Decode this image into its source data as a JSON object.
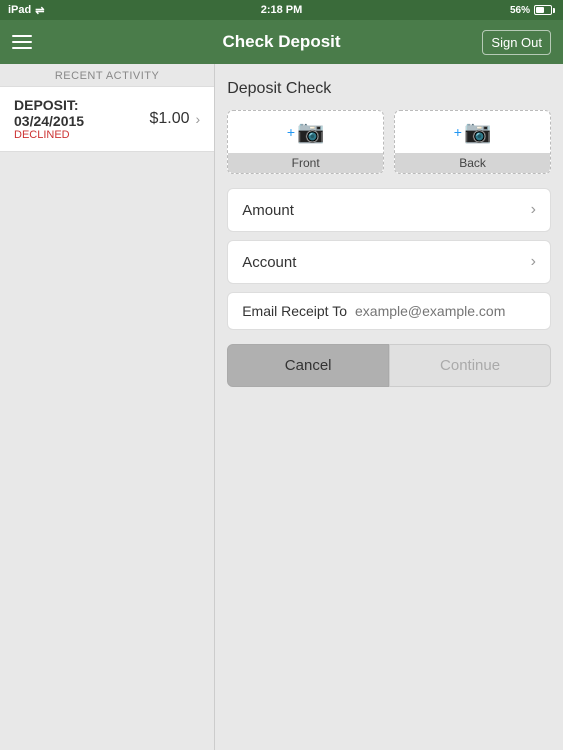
{
  "statusBar": {
    "carrier": "iPad",
    "time": "2:18 PM",
    "battery_pct": "56%",
    "wifi": true
  },
  "navBar": {
    "title": "Check Deposit",
    "signOut": "Sign Out"
  },
  "leftPanel": {
    "sectionHeader": "RECENT ACTIVITY",
    "deposit": {
      "label": "DEPOSIT:",
      "date": "03/24/2015",
      "status": "DECLINED",
      "amount": "$1.00"
    }
  },
  "rightPanel": {
    "title": "Deposit Check",
    "front_label": "Front",
    "back_label": "Back",
    "amount_label": "Amount",
    "account_label": "Account",
    "email_label": "Email Receipt To",
    "email_placeholder": "example@example.com",
    "cancel_btn": "Cancel",
    "continue_btn": "Continue"
  }
}
